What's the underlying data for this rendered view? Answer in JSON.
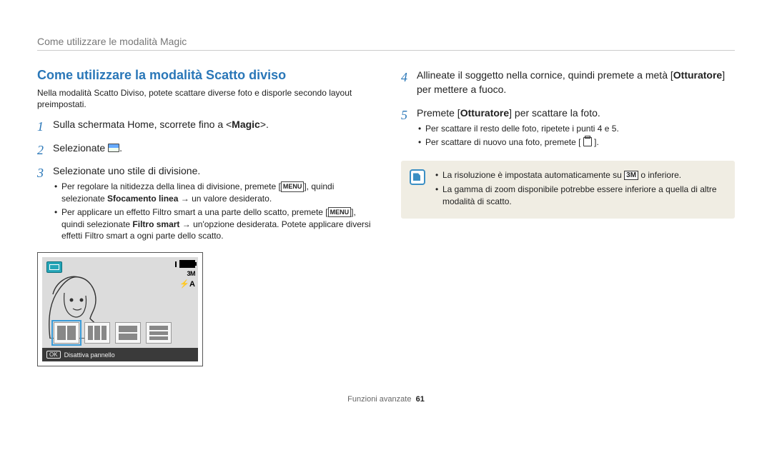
{
  "header": "Come utilizzare le modalità Magic",
  "section_title": "Come utilizzare la modalità Scatto diviso",
  "intro": "Nella modalità Scatto Diviso, potete scattare diverse foto e disporle secondo layout preimpostati.",
  "left_steps": [
    {
      "text_parts": [
        "Sulla schermata Home, scorrete fino a <",
        "Magic",
        ">."
      ],
      "bold_idx": 1
    },
    {
      "text_parts": [
        "Selezionate ",
        "ICON_SPLIT",
        "."
      ],
      "icon_idx": 1
    },
    {
      "text_parts": [
        "Selezionate uno stile di divisione."
      ],
      "sub": [
        {
          "parts": [
            "Per regolare la nitidezza della linea di divisione, premete [",
            "MENU_BOX",
            "], quindi selezionate ",
            "Sfocamento linea",
            " → un valore desiderato."
          ],
          "menu_idx": [
            1
          ],
          "bold_idx": [
            3
          ]
        },
        {
          "parts": [
            "Per applicare un effetto Filtro smart a una parte dello scatto, premete [",
            "MENU_BOX",
            "], quindi selezionate ",
            "Filtro smart",
            " → un'opzione desiderata. Potete applicare diversi effetti Filtro smart a ogni parte dello scatto."
          ],
          "menu_idx": [
            1
          ],
          "bold_idx": [
            3
          ]
        }
      ]
    }
  ],
  "right_steps": [
    {
      "text_parts": [
        "Allineate il soggetto nella cornice, quindi premete a metà [",
        "Otturatore",
        "] per mettere a fuoco."
      ],
      "bold_idx": 1
    },
    {
      "text_parts": [
        "Premete [",
        "Otturatore",
        "] per scattare la foto."
      ],
      "bold_idx": 1,
      "sub": [
        {
          "parts": [
            "Per scattare il resto delle foto, ripetete i punti 4 e 5."
          ]
        },
        {
          "parts": [
            "Per scattare di nuovo una foto, premete [ ",
            "TRASH_ICON",
            " ]."
          ],
          "trash_idx": [
            1
          ]
        }
      ]
    }
  ],
  "note": [
    {
      "parts": [
        "La risoluzione è impostata automaticamente su ",
        "3M_ICON",
        " o inferiore."
      ],
      "threeM_idx": [
        1
      ]
    },
    {
      "parts": [
        "La gamma di zoom disponibile potrebbe essere inferiore a quella di altre modalità di scatto."
      ]
    }
  ],
  "lcd": {
    "status_3m": "3M",
    "status_flash": "⚡A",
    "bottom_ok": "OK",
    "bottom_label": "Disattiva pannello",
    "portrait_alt": "portrait"
  },
  "footer": {
    "label": "Funzioni avanzate",
    "page": "61"
  }
}
